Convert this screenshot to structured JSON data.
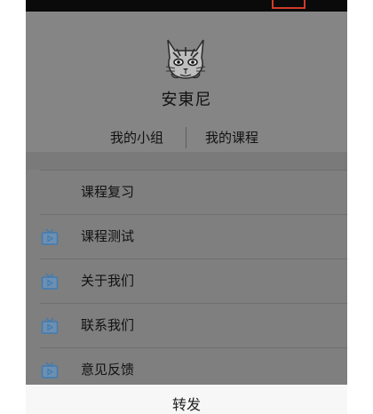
{
  "profile": {
    "username": "安東尼",
    "links": {
      "groups": "我的小组",
      "courses": "我的课程"
    }
  },
  "menu": {
    "items": [
      {
        "label": "课程复习",
        "icon": "tv-icon"
      },
      {
        "label": "课程测试",
        "icon": "tv-icon"
      },
      {
        "label": "关于我们",
        "icon": "tv-icon"
      },
      {
        "label": "联系我们",
        "icon": "tv-icon"
      },
      {
        "label": "意见反馈",
        "icon": "tv-icon"
      }
    ]
  },
  "share_bar": {
    "label": "转发"
  },
  "colors": {
    "overlay": "#7f7f7f",
    "icon_blue": "#4a8fc9",
    "highlight": "#d13b2a"
  }
}
